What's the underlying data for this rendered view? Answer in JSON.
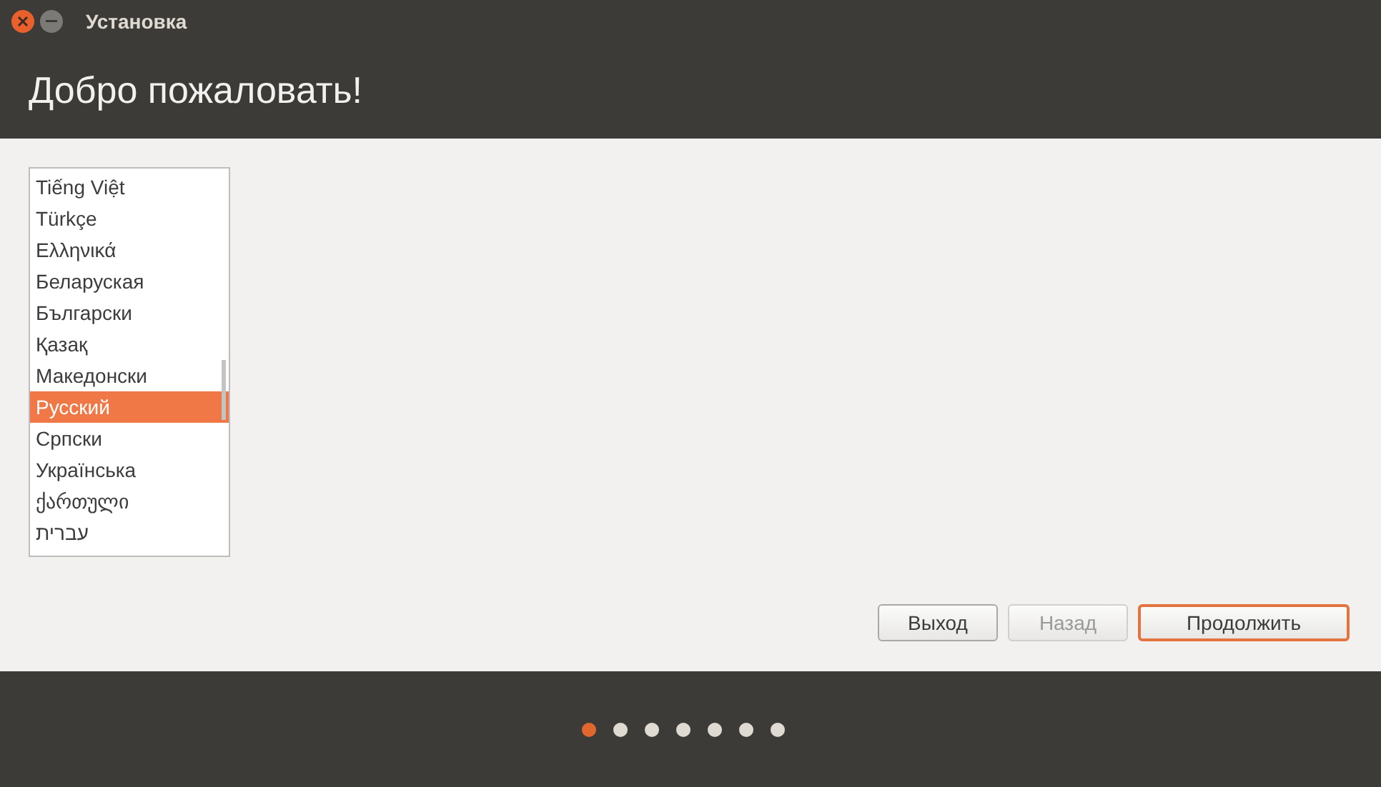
{
  "window": {
    "title": "Установка"
  },
  "header": {
    "title": "Добро пожаловать!"
  },
  "languages": [
    {
      "label": "Tiếng Việt",
      "selected": false
    },
    {
      "label": "Türkçe",
      "selected": false
    },
    {
      "label": "Ελληνικά",
      "selected": false
    },
    {
      "label": "Беларуская",
      "selected": false
    },
    {
      "label": "Български",
      "selected": false
    },
    {
      "label": "Қазақ",
      "selected": false
    },
    {
      "label": "Македонски",
      "selected": false
    },
    {
      "label": "Русский",
      "selected": true
    },
    {
      "label": "Српски",
      "selected": false
    },
    {
      "label": "Українська",
      "selected": false
    },
    {
      "label": "ქართული",
      "selected": false
    },
    {
      "label": "עברית",
      "selected": false
    }
  ],
  "buttons": [
    {
      "label": "Выход",
      "disabled": false,
      "default": false
    },
    {
      "label": "Назад",
      "disabled": true,
      "default": false
    },
    {
      "label": "Продолжить",
      "disabled": false,
      "default": true
    }
  ],
  "steps": [
    {
      "selected": true
    },
    {
      "selected": false
    },
    {
      "selected": false
    },
    {
      "selected": false
    },
    {
      "selected": false
    },
    {
      "selected": false
    },
    {
      "selected": false
    }
  ]
}
